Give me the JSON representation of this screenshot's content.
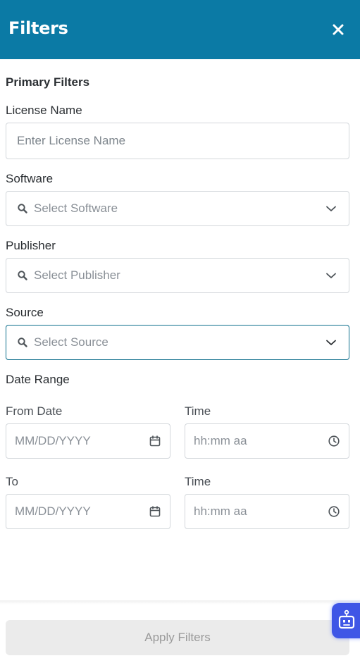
{
  "header": {
    "title": "Filters",
    "close_icon": "close-icon"
  },
  "primary_filters": {
    "title": "Primary Filters",
    "license_name": {
      "label": "License Name",
      "placeholder": "Enter License Name",
      "value": ""
    },
    "software": {
      "label": "Software",
      "placeholder": "Select Software",
      "value": ""
    },
    "publisher": {
      "label": "Publisher",
      "placeholder": "Select Publisher",
      "value": ""
    },
    "source": {
      "label": "Source",
      "placeholder": "Select Source",
      "value": ""
    }
  },
  "date_range": {
    "label": "Date Range",
    "from_date": {
      "label": "From Date",
      "placeholder": "MM/DD/YYYY"
    },
    "from_time": {
      "label": "Time",
      "placeholder": "hh:mm aa"
    },
    "to_date": {
      "label": "To",
      "placeholder": "MM/DD/YYYY"
    },
    "to_time": {
      "label": "Time",
      "placeholder": "hh:mm aa"
    }
  },
  "footer": {
    "apply_label": "Apply Filters"
  },
  "icons": {
    "search": "search-icon",
    "dropdown": "chevron-down-icon",
    "calendar": "calendar-icon",
    "clock": "clock-icon",
    "assistant": "robot-icon"
  },
  "colors": {
    "header_bg": "#0b7aa5",
    "active_border": "#0f6f8c",
    "assistant_bg": "#3f56e6",
    "apply_bg": "#ebebeb"
  }
}
